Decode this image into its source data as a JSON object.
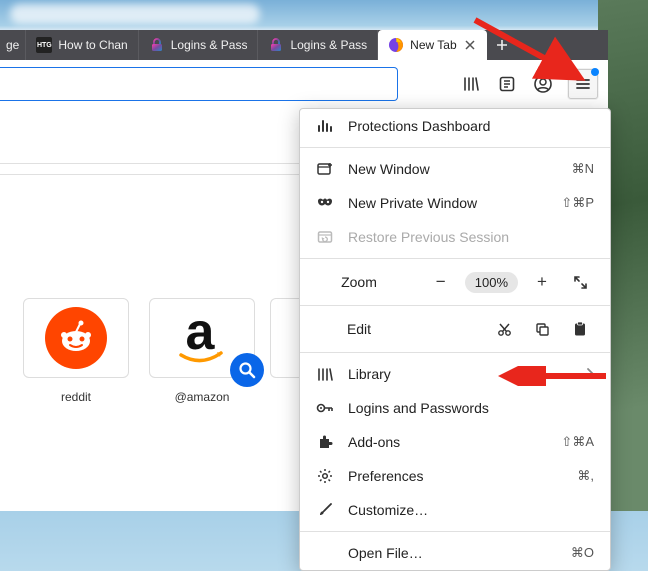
{
  "tabs": [
    {
      "label": "ge",
      "icon": ""
    },
    {
      "label": "How to Chan",
      "icon": "htg"
    },
    {
      "label": "Logins & Pass",
      "icon": "lock-gradient"
    },
    {
      "label": "Logins & Pass",
      "icon": "lock-gradient"
    },
    {
      "label": "New Tab",
      "icon": "firefox",
      "active": true
    }
  ],
  "shortcuts": {
    "reddit": "reddit",
    "amazon": "@amazon"
  },
  "menu": {
    "protections": "Protections Dashboard",
    "newWindow": {
      "label": "New Window",
      "shortcut": "⌘N"
    },
    "newPrivate": {
      "label": "New Private Window",
      "shortcut": "⇧⌘P"
    },
    "restore": {
      "label": "Restore Previous Session"
    },
    "zoom": {
      "label": "Zoom",
      "value": "100%"
    },
    "edit": {
      "label": "Edit"
    },
    "library": "Library",
    "logins": "Logins and Passwords",
    "addons": {
      "label": "Add-ons",
      "shortcut": "⇧⌘A"
    },
    "preferences": {
      "label": "Preferences",
      "shortcut": "⌘,"
    },
    "customize": "Customize…",
    "openFile": {
      "label": "Open File…",
      "shortcut": "⌘O"
    }
  }
}
